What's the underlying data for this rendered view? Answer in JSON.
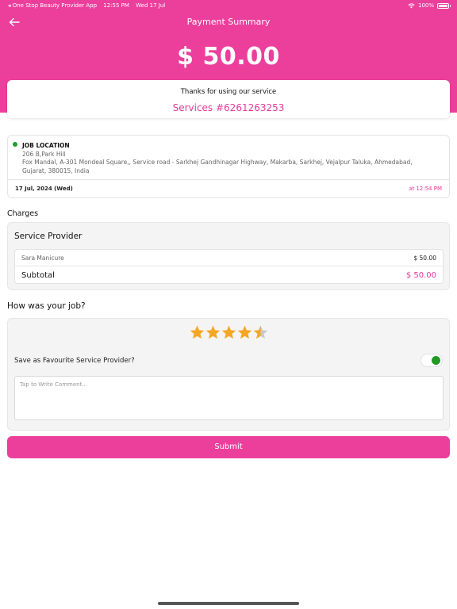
{
  "status_bar": {
    "app_back": "◂ One Stop Beauty Provider App",
    "time": "12:55 PM",
    "date": "Wed 17 Jul",
    "battery": "100%"
  },
  "header": {
    "title": "Payment Summary",
    "amount": "$ 50.00",
    "color": "#ec3f9c"
  },
  "thanks": {
    "message": "Thanks for using our service",
    "service_number": "Services #6261263253"
  },
  "job_location": {
    "heading": "JOB LOCATION",
    "line1": "206 B,Park Hill",
    "line2": "Fox Mandal, A-301 Mondeal Square,, Service road - Sarkhej Gandhinagar Highway, Makarba, Sarkhej, Vejalpur Taluka, Ahmedabad, Gujarat, 380015, India",
    "date": "17 Jul, 2024 (Wed)",
    "time": "at 12:54 PM",
    "status_color": "#1e9e2e"
  },
  "charges": {
    "label": "Charges",
    "provider_title": "Service Provider",
    "items": [
      {
        "name": "Sara Manicure",
        "price": "$ 50.00"
      }
    ],
    "subtotal_label": "Subtotal",
    "subtotal_value": "$ 50.00"
  },
  "rating": {
    "question": "How was your job?",
    "stars": 4.5,
    "max_stars": 5,
    "star_color": "#f5a623",
    "favourite_label": "Save as Favourite Service Provider?",
    "favourite_on": true,
    "comment_placeholder": "Tap to Write Comment...",
    "comment_value": ""
  },
  "submit": {
    "label": "Submit"
  }
}
